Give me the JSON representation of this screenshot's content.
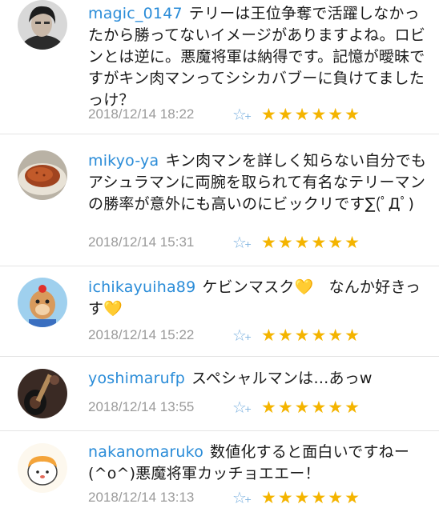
{
  "comments": [
    {
      "user": "magic_0147",
      "text": "テリーは王位争奪で活躍しなかったから勝ってないイメージがありますよね。ロビンとは逆に。悪魔将軍は納得です。記憶が曖昧ですがキン肉マンってシシカバブーに負けてましたっけ？",
      "date": "2018/12/14 18:22",
      "stars": "★★★★★★",
      "avatar_icon": "man-portrait-avatar"
    },
    {
      "user": "mikyo-ya",
      "text": "キン肉マンを詳しく知らない自分でもアシュラマンに両腕を取られて有名なテリーマンの勝率が意外にも高いのにビックリです∑(ﾟДﾟ)",
      "date": "2018/12/14 15:31",
      "stars": "★★★★★★",
      "avatar_icon": "food-dish-avatar"
    },
    {
      "user": "ichikayuiha89",
      "text": "ケビンマスク💛　なんか好きっす💛",
      "date": "2018/12/14 15:22",
      "stars": "★★★★★★",
      "avatar_icon": "deer-character-avatar"
    },
    {
      "user": "yoshimarufp",
      "text": "スペシャルマンは…あっw",
      "date": "2018/12/14 13:55",
      "stars": "★★★★★★",
      "avatar_icon": "guitar-avatar"
    },
    {
      "user": "nakanomaruko",
      "text": "数値化すると面白いですねー(^o^)悪魔将軍カッチョエエー！",
      "date": "2018/12/14 13:13",
      "stars": "★★★★★★",
      "avatar_icon": "maru-character-avatar"
    }
  ],
  "favorite_icon": "star-plus-icon",
  "colors": {
    "username": "#2a8cd8",
    "date": "#9a9a9a",
    "star": "#f4b400",
    "divider": "#e4e4e4"
  }
}
